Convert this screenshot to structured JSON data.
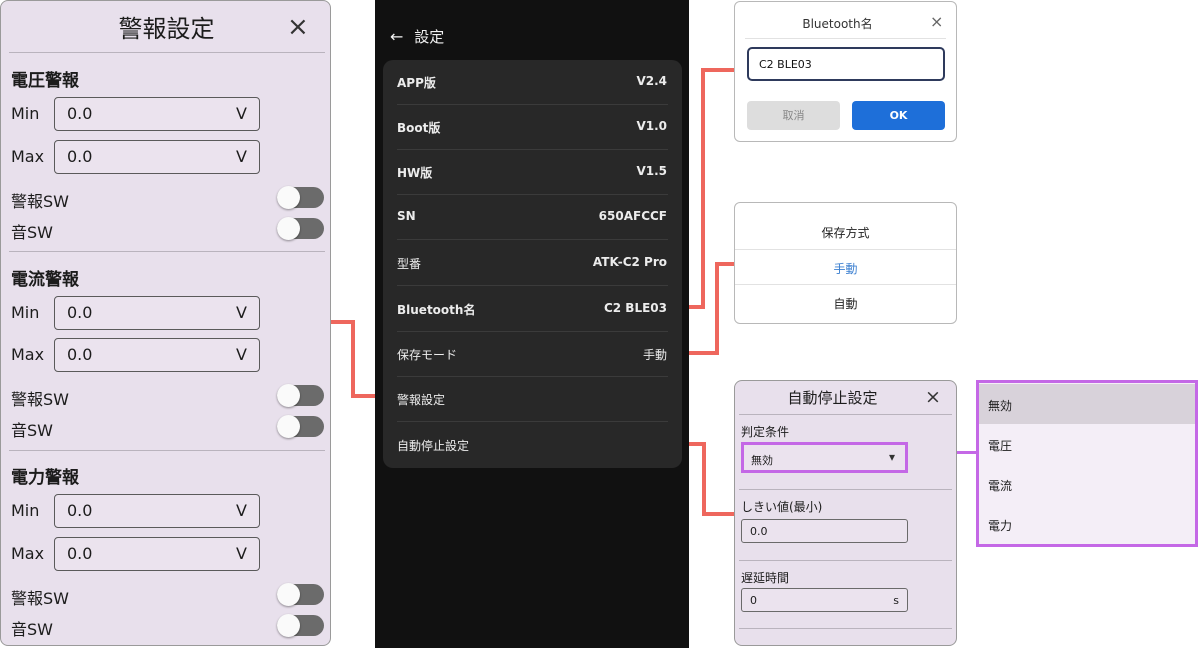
{
  "alarm_settings": {
    "title": "警報設定",
    "close_icon": "×",
    "sections": [
      {
        "title": "電圧警報",
        "min_label": "Min",
        "min_value": "0.0",
        "min_unit": "V",
        "max_label": "Max",
        "max_value": "0.0",
        "max_unit": "V",
        "alarm_sw_label": "警報SW",
        "alarm_sw_on": false,
        "sound_sw_label": "音SW",
        "sound_sw_on": false
      },
      {
        "title": "電流警報",
        "min_label": "Min",
        "min_value": "0.0",
        "min_unit": "V",
        "max_label": "Max",
        "max_value": "0.0",
        "max_unit": "V",
        "alarm_sw_label": "警報SW",
        "alarm_sw_on": false,
        "sound_sw_label": "音SW",
        "sound_sw_on": false
      },
      {
        "title": "電力警報",
        "min_label": "Min",
        "min_value": "0.0",
        "min_unit": "V",
        "max_label": "Max",
        "max_value": "0.0",
        "max_unit": "V",
        "alarm_sw_label": "警報SW",
        "alarm_sw_on": false,
        "sound_sw_label": "音SW",
        "sound_sw_on": false
      }
    ]
  },
  "settings": {
    "back_icon": "←",
    "title": "設定",
    "rows": [
      {
        "label": "APP版",
        "value": "V2.4"
      },
      {
        "label": "Boot版",
        "value": "V1.0"
      },
      {
        "label": "HW版",
        "value": "V1.5"
      },
      {
        "label": "SN",
        "value": "650AFCCF"
      },
      {
        "label": "型番",
        "value": "ATK-C2 Pro"
      },
      {
        "label": "Bluetooth名",
        "value": "C2 BLE03"
      },
      {
        "label": "保存モード",
        "value": "手動"
      },
      {
        "label": "警報設定",
        "value": ""
      },
      {
        "label": "自動停止設定",
        "value": ""
      }
    ]
  },
  "bluetooth_dialog": {
    "title": "Bluetooth名",
    "close_icon": "×",
    "input_value": "C2 BLE03",
    "cancel_label": "取消",
    "ok_label": "OK"
  },
  "save_dialog": {
    "title": "保存方式",
    "options": [
      "手動",
      "自動"
    ],
    "selected_index": 0
  },
  "auto_stop": {
    "title": "自動停止設定",
    "close_icon": "×",
    "condition_label": "判定条件",
    "condition_value": "無効",
    "dropdown_arrow": "▾",
    "threshold_label": "しきい値(最小)",
    "threshold_value": "0.0",
    "delay_label": "遅延時間",
    "delay_value": "0",
    "delay_unit": "s"
  },
  "condition_options": {
    "items": [
      "無効",
      "電圧",
      "電流",
      "電力"
    ],
    "selected_index": 0
  },
  "colors": {
    "connector": "#ee675d",
    "highlight": "#c468e6",
    "ok_button": "#1e6fd9",
    "selected_option": "#3b7fd0"
  }
}
